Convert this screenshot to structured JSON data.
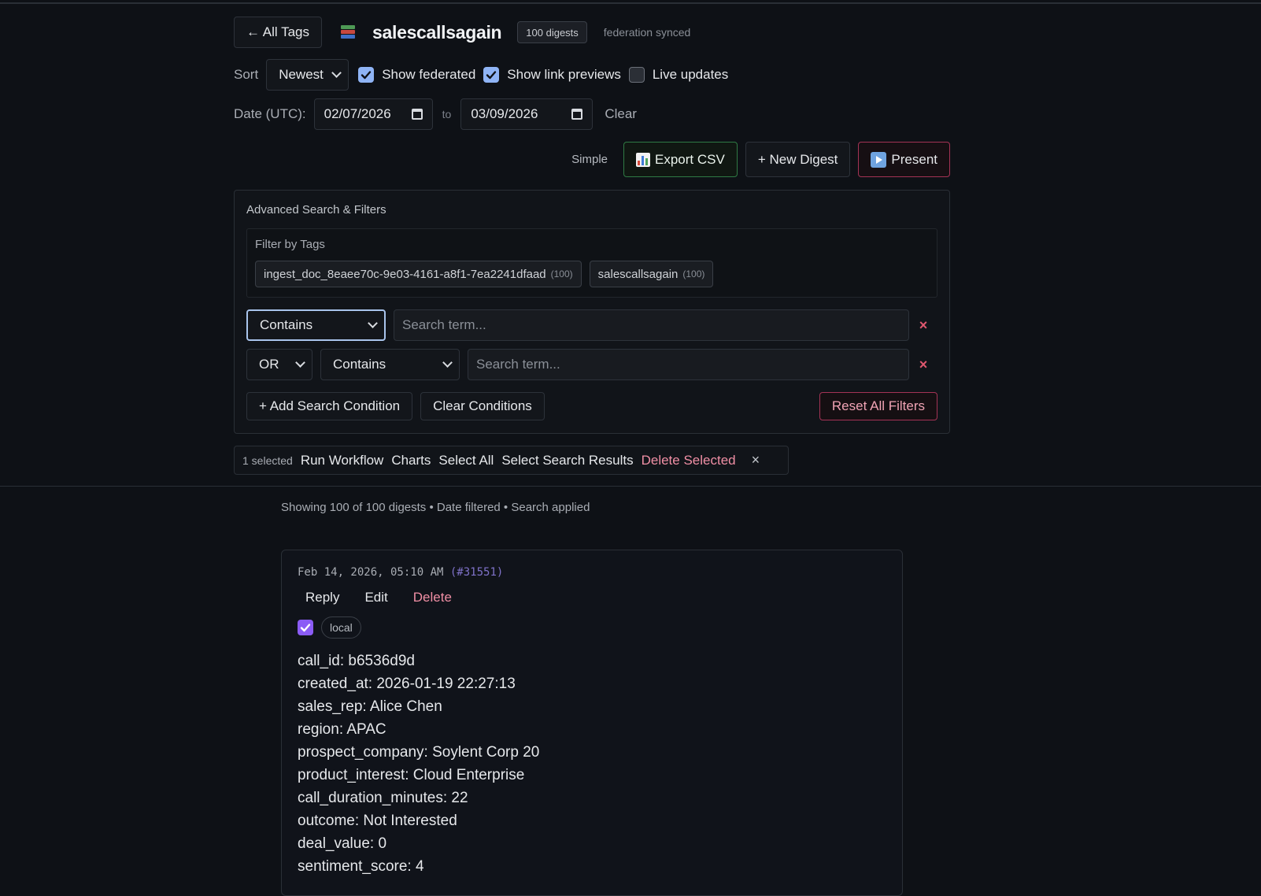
{
  "header": {
    "back_label": "← All Tags",
    "title": "salescallsagain",
    "count_badge": "100 digests",
    "status": "federation synced"
  },
  "controls": {
    "sort_label": "Sort",
    "sort_value": "Newest",
    "show_federated": {
      "label": "Show federated",
      "checked": true
    },
    "show_link_previews": {
      "label": "Show link previews",
      "checked": true
    },
    "live_updates": {
      "label": "Live updates",
      "checked": false
    }
  },
  "date_filter": {
    "label": "Date (UTC):",
    "from": "02/07/2026",
    "to_label": "to",
    "to": "03/09/2026",
    "clear_label": "Clear"
  },
  "actions": {
    "simple_label": "Simple",
    "export_label": "Export CSV",
    "new_label": "+ New Digest",
    "present_label": "Present"
  },
  "advanced": {
    "title": "Advanced Search & Filters",
    "tags_title": "Filter by Tags",
    "tags": [
      {
        "name": "ingest_doc_8eaee70c-9e03-4161-a8f1-7ea2241dfaad",
        "count": "(100)"
      },
      {
        "name": "salescallsagain",
        "count": "(100)"
      }
    ],
    "conditions": [
      {
        "mode": "Contains",
        "placeholder": "Search term..."
      },
      {
        "joiner": "OR",
        "mode": "Contains",
        "placeholder": "Search term..."
      }
    ],
    "remove_icon": "×",
    "add_label": "+ Add Search Condition",
    "clear_label": "Clear Conditions",
    "reset_label": "Reset All Filters"
  },
  "selection": {
    "count": "1 selected",
    "run_workflow": "Run Workflow",
    "charts": "Charts",
    "select_all": "Select All",
    "select_results": "Select Search Results",
    "delete_selected": "Delete Selected",
    "close": "×"
  },
  "status_line": "Showing 100 of 100 digests • Date filtered • Search applied",
  "digest": {
    "timestamp": "Feb 14, 2026, 05:10 AM",
    "id": "(#31551)",
    "reply": "Reply",
    "edit": "Edit",
    "delete": "Delete",
    "selected": true,
    "origin": "local",
    "fields": [
      "call_id: b6536d9d",
      "created_at: 2026-01-19 22:27:13",
      "sales_rep: Alice Chen",
      "region: APAC",
      "prospect_company: Soylent Corp 20",
      "product_interest: Cloud Enterprise",
      "call_duration_minutes: 22",
      "outcome: Not Interested",
      "deal_value: 0",
      "sentiment_score: 4"
    ]
  },
  "colors": {
    "background": "#0e1116",
    "accent_checkbox": "#8fb4f5",
    "danger": "#f08fa5",
    "success_border": "#2f7a44",
    "selected_checkbox": "#8b5cf6"
  }
}
